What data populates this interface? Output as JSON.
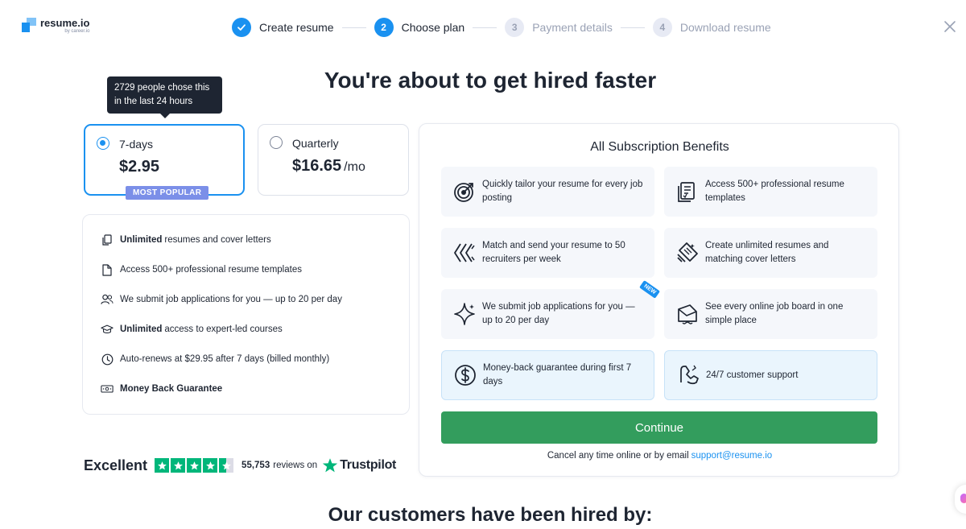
{
  "header": {
    "logo_name": "resume.io",
    "logo_sub": "by career.io",
    "steps": [
      {
        "number": "1",
        "label": "Create resume",
        "state": "done"
      },
      {
        "number": "2",
        "label": "Choose plan",
        "state": "active"
      },
      {
        "number": "3",
        "label": "Payment details",
        "state": "pending"
      },
      {
        "number": "4",
        "label": "Download resume",
        "state": "pending"
      }
    ],
    "close_icon": "close-icon"
  },
  "headline": "You're about to get hired faster",
  "tooltip": "2729 people chose this in the last 24 hours",
  "plans": [
    {
      "name": "7-days",
      "price": "$2.95",
      "unit": "",
      "selected": true,
      "badge": "MOST POPULAR"
    },
    {
      "name": "Quarterly",
      "price": "$16.65",
      "unit": "/mo",
      "selected": false
    }
  ],
  "features": [
    {
      "icon": "copy-icon",
      "bold": "Unlimited",
      "text": "resumes and cover letters"
    },
    {
      "icon": "document-icon",
      "bold": "",
      "text": "Access 500+ professional resume templates"
    },
    {
      "icon": "users-icon",
      "bold": "",
      "text": "We submit job applications for you — up to 20 per day"
    },
    {
      "icon": "graduation-cap-icon",
      "bold": "Unlimited",
      "text": "access to expert-led courses"
    },
    {
      "icon": "clock-icon",
      "bold": "",
      "text": "Auto-renews at $29.95 after 7 days (billed monthly)"
    },
    {
      "icon": "money-icon",
      "bold": "Money Back Guarantee",
      "text": ""
    }
  ],
  "trustpilot": {
    "rating_word": "Excellent",
    "stars": 4.5,
    "count": "55,753",
    "reviews_on": "reviews on",
    "brand": "Trustpilot"
  },
  "benefits": {
    "title": "All Subscription Benefits",
    "items": [
      {
        "icon": "target-icon",
        "text": "Quickly tailor your resume for every job posting",
        "highlight": false
      },
      {
        "icon": "templates-icon",
        "text": "Access 500+ professional resume templates",
        "highlight": false
      },
      {
        "icon": "send-arrows-icon",
        "text": "Match and send your resume to 50 recruiters per week",
        "highlight": false
      },
      {
        "icon": "documents-stack-icon",
        "text": "Create unlimited resumes and matching cover letters",
        "highlight": false
      },
      {
        "icon": "sparkle-icon",
        "text": "We submit job applications for you — up to 20 per day",
        "highlight": false,
        "tag": "NEW"
      },
      {
        "icon": "job-board-icon",
        "text": "See every online job board in one simple place",
        "highlight": false
      },
      {
        "icon": "dollar-icon",
        "text": "Money-back guarantee during first 7 days",
        "highlight": true
      },
      {
        "icon": "support-icon",
        "text": "24/7 customer support",
        "highlight": true
      }
    ],
    "continue_label": "Continue",
    "cancel_text": "Cancel any time online or by email",
    "support_email": "support@resume.io"
  },
  "hired_by": "Our customers have been hired by:",
  "colors": {
    "accent": "#1a91f0",
    "continue": "#339d5d",
    "trustpilot": "#00b67a",
    "badge": "#7b8fe8"
  }
}
